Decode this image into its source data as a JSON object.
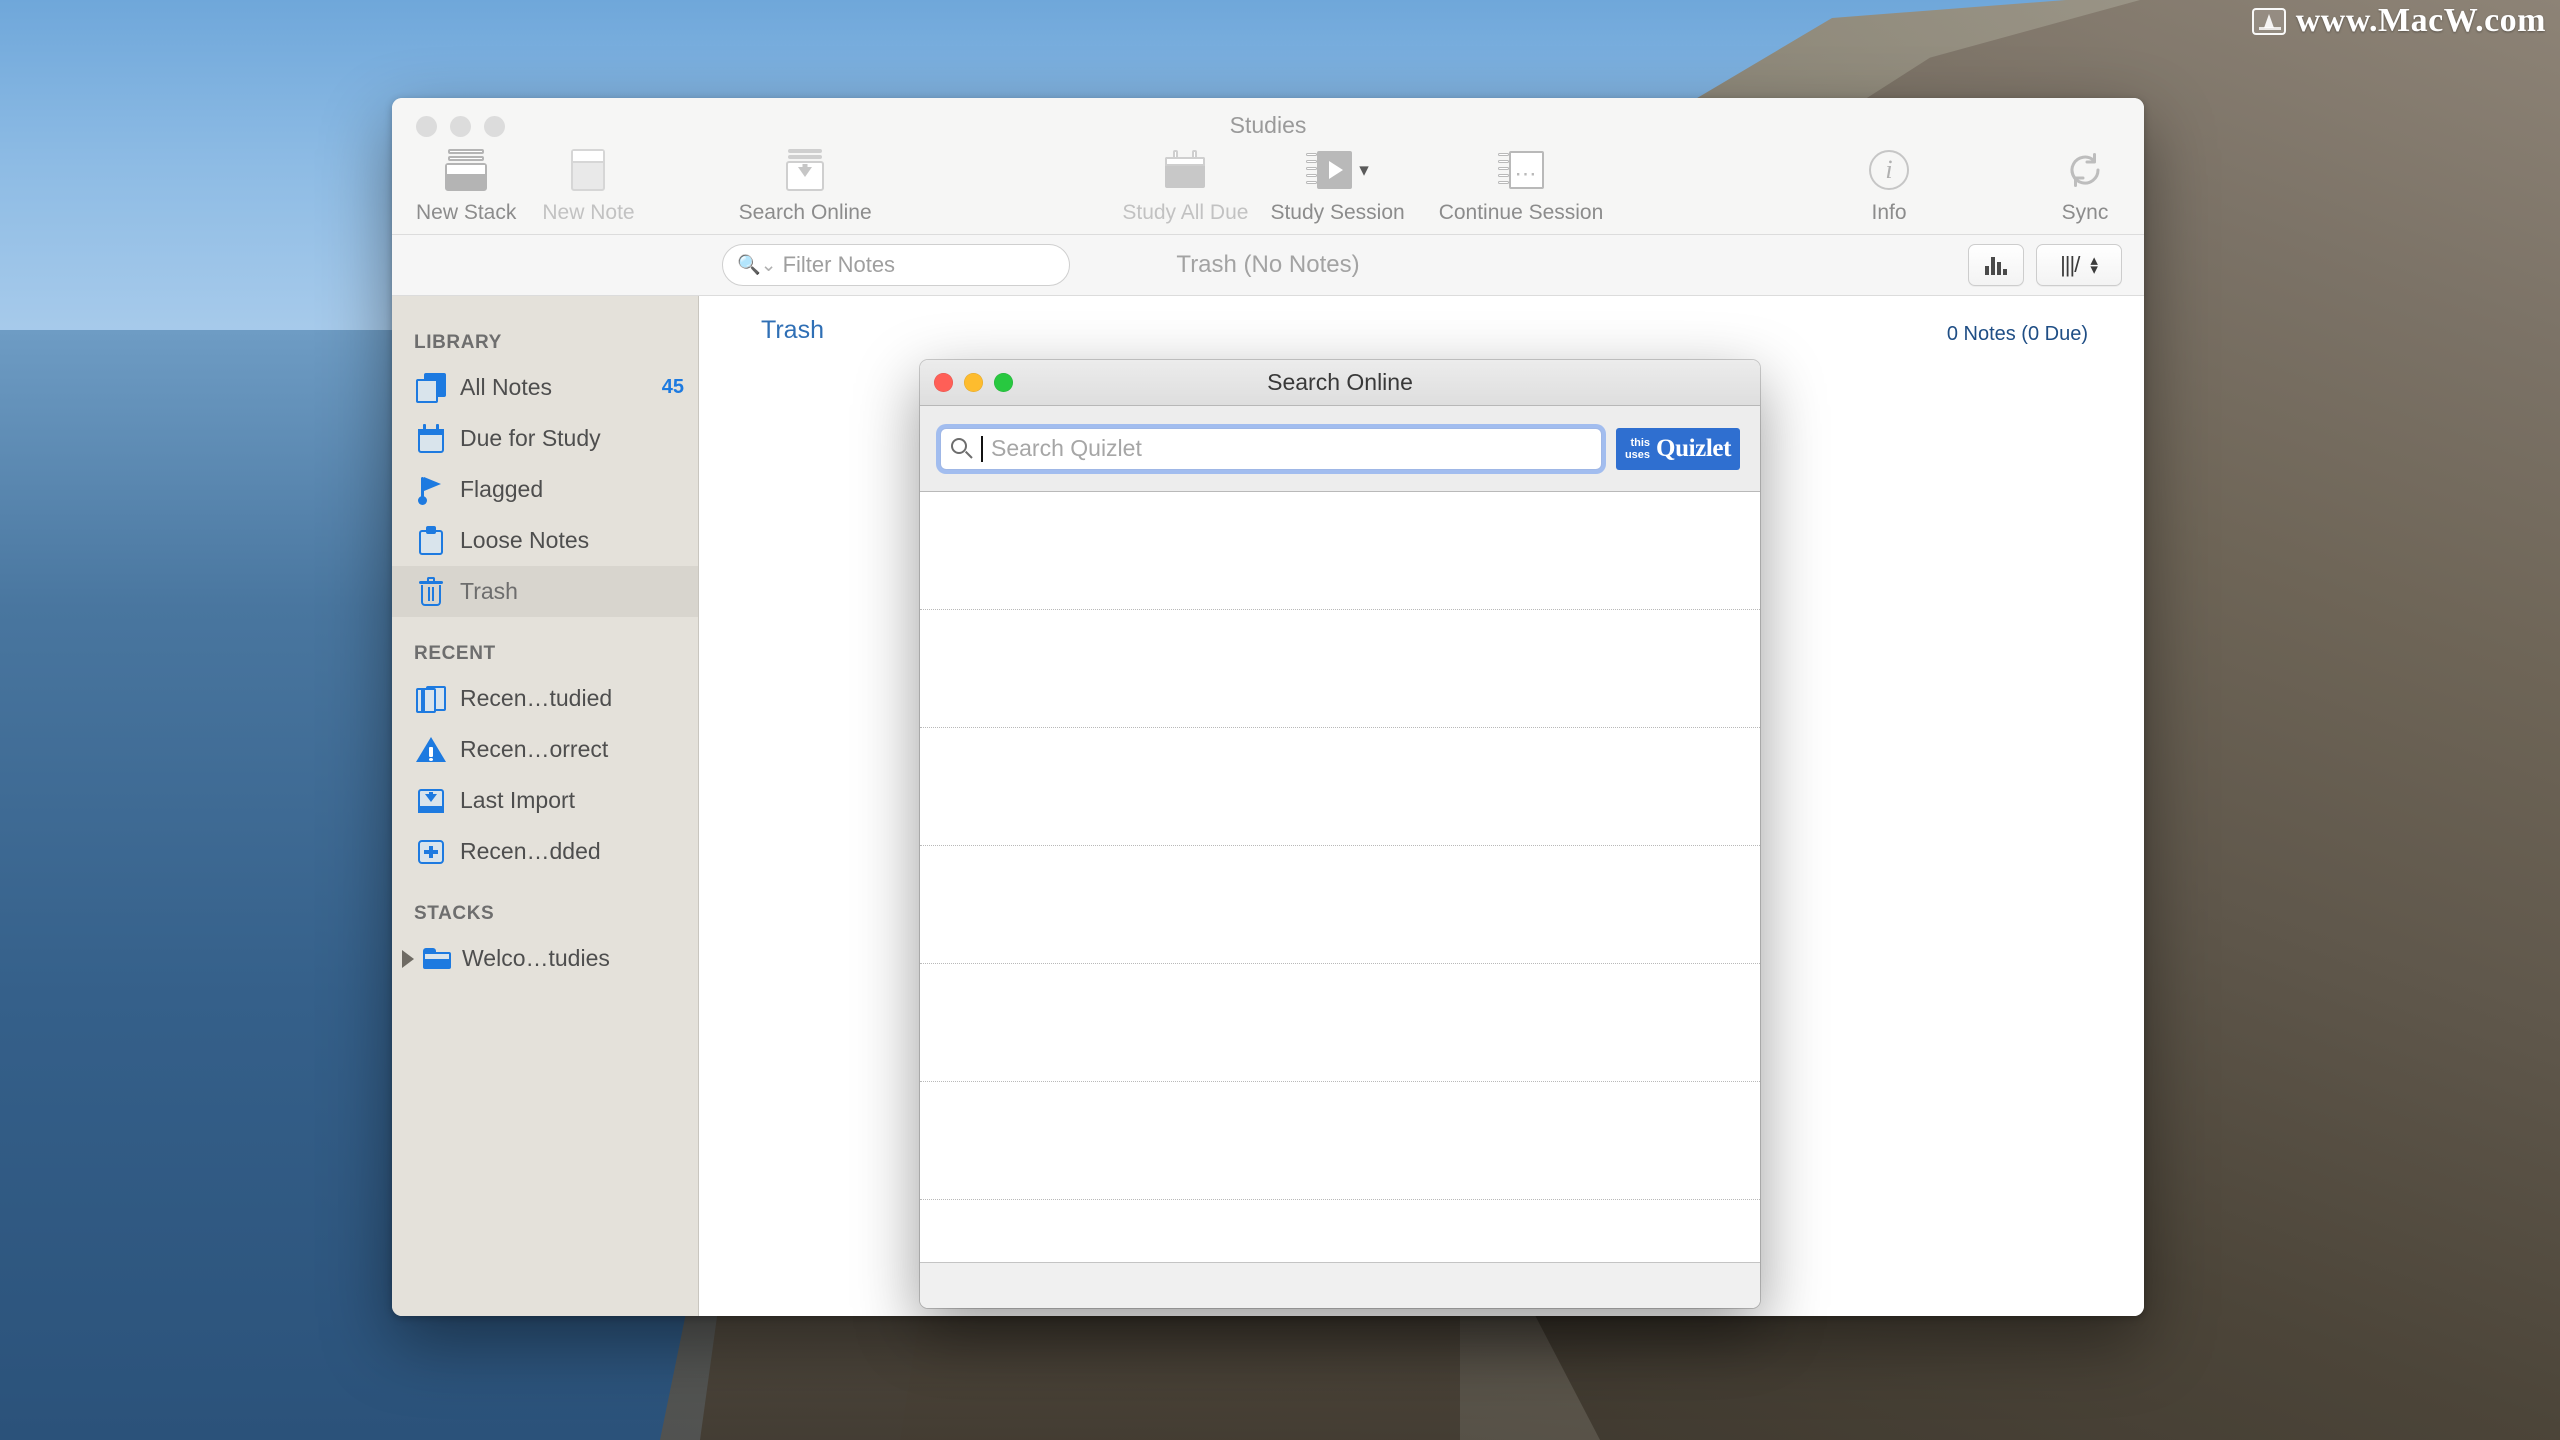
{
  "watermark": {
    "text": "www.MacW.com",
    "icon": "monitor-icon"
  },
  "window": {
    "title": "Studies",
    "traffic_lights": [
      "close",
      "minimize",
      "zoom"
    ]
  },
  "toolbar": {
    "items": [
      {
        "label": "New Stack",
        "icon": "stack-icon",
        "enabled": true
      },
      {
        "label": "New Note",
        "icon": "note-icon",
        "enabled": false
      },
      {
        "label": "Search Online",
        "icon": "download-stack-icon",
        "enabled": true
      },
      {
        "label": "Study All Due",
        "icon": "calendar-icon",
        "enabled": false
      },
      {
        "label": "Study Session",
        "icon": "play-card-icon",
        "enabled": true
      },
      {
        "label": "Continue Session",
        "icon": "card-ellipsis-icon",
        "enabled": true
      },
      {
        "label": "Info",
        "icon": "info-icon",
        "enabled": true
      },
      {
        "label": "Sync",
        "icon": "sync-icon",
        "enabled": true
      }
    ]
  },
  "filter_bar": {
    "search_placeholder": "Filter Notes",
    "search_value": "",
    "search_icon": "magnifier-dropdown-icon",
    "content_title": "Trash (No Notes)",
    "stats_button_icon": "bar-chart-icon",
    "view_button_label": "|||/",
    "view_stepper_icon": "up-down-chevrons-icon"
  },
  "sidebar": {
    "sections": [
      {
        "header": "LIBRARY",
        "items": [
          {
            "label": "All Notes",
            "icon": "all-notes-icon",
            "badge": "45",
            "selected": false
          },
          {
            "label": "Due for Study",
            "icon": "calendar-icon",
            "badge": "",
            "selected": false
          },
          {
            "label": "Flagged",
            "icon": "flag-icon",
            "badge": "",
            "selected": false
          },
          {
            "label": "Loose Notes",
            "icon": "clipboard-icon",
            "badge": "",
            "selected": false
          },
          {
            "label": "Trash",
            "icon": "trash-icon",
            "badge": "",
            "selected": true
          }
        ]
      },
      {
        "header": "RECENT",
        "items": [
          {
            "label": "Recen…tudied",
            "icon": "book-icon",
            "badge": "",
            "selected": false
          },
          {
            "label": "Recen…orrect",
            "icon": "warning-icon",
            "badge": "",
            "selected": false
          },
          {
            "label": "Last Import",
            "icon": "import-icon",
            "badge": "",
            "selected": false
          },
          {
            "label": "Recen…dded",
            "icon": "plus-box-icon",
            "badge": "",
            "selected": false
          }
        ]
      },
      {
        "header": "STACKS",
        "items": [
          {
            "label": "Welco…tudies",
            "icon": "folder-icon",
            "badge": "",
            "selected": false,
            "disclosure": true
          }
        ]
      }
    ]
  },
  "content": {
    "breadcrumb": "Trash",
    "note_count": "0 Notes (0 Due)"
  },
  "modal": {
    "title": "Search Online",
    "traffic_lights": [
      "close",
      "minimize",
      "zoom"
    ],
    "search_placeholder": "Search Quizlet",
    "search_value": "",
    "search_icon": "magnifier-icon",
    "badge": {
      "small_line1": "this",
      "small_line2": "uses",
      "word": "Quizlet"
    },
    "results": [],
    "result_row_count": 7
  },
  "colors": {
    "accent_blue": "#1d7ae0",
    "badge_blue": "#2f6fd0",
    "breadcrumb_blue": "#2f6fb5",
    "sidebar_bg": "#e4e1da",
    "window_bg": "#f6f6f6",
    "traffic_red": "#ff5f57",
    "traffic_yellow": "#febc2e",
    "traffic_green": "#28c840"
  }
}
